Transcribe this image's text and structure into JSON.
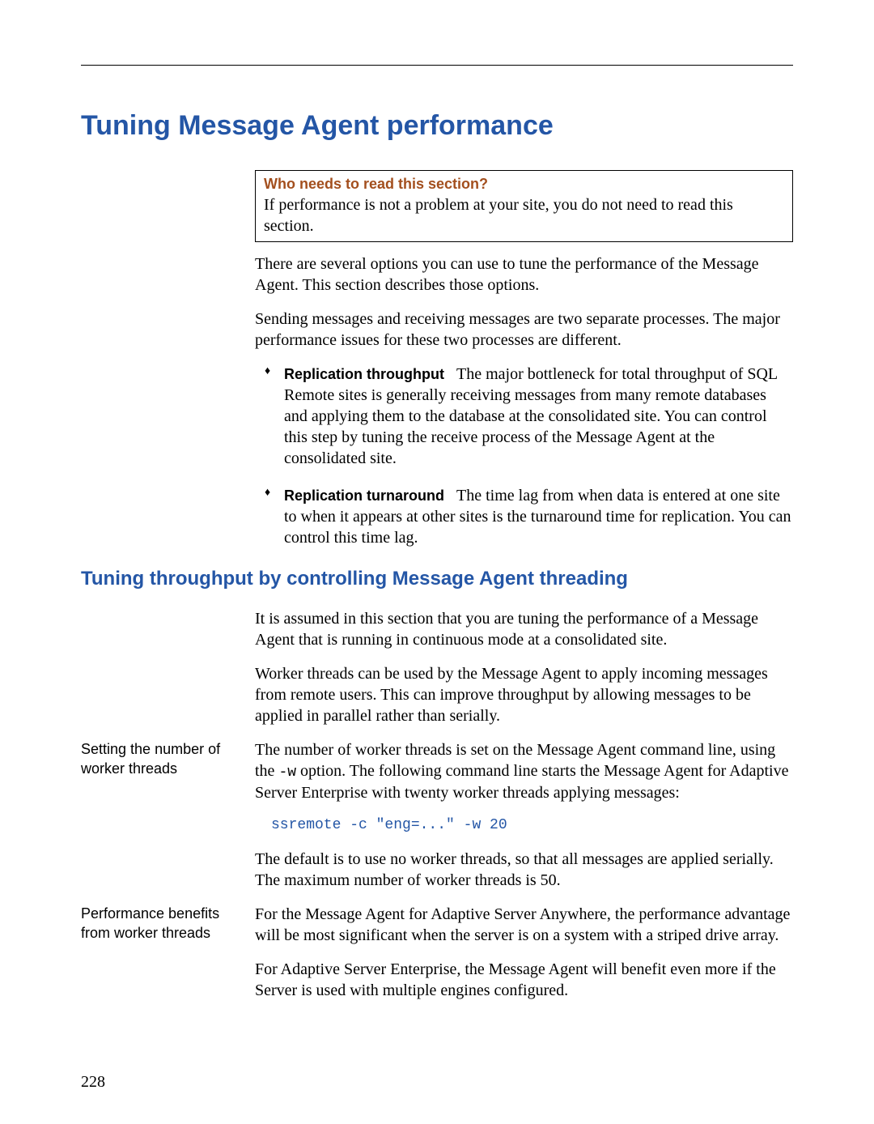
{
  "page_number": "228",
  "title": "Tuning Message Agent performance",
  "callout": {
    "heading": "Who needs to read this section?",
    "body": "If performance is not a problem at your site, you do not need to read this section."
  },
  "intro_paras": [
    "There are several options you can use to tune the performance of the Message Agent. This section describes those options.",
    "Sending messages and receiving messages are two separate processes. The major performance issues for these two processes are different."
  ],
  "bullets": [
    {
      "label": "Replication throughput",
      "text": "The major bottleneck for total throughput of SQL Remote sites is generally receiving messages from many remote databases and applying them to the database at the consolidated site. You can control this step by tuning the receive process of the Message Agent at the consolidated site."
    },
    {
      "label": "Replication turnaround",
      "text": "The time lag from when data is entered at one site to when it appears at other sites is the turnaround time for replication. You can control this time lag."
    }
  ],
  "subsection_title": "Tuning throughput by controlling Message Agent threading",
  "sub_intro": [
    "It is assumed in this section that you are tuning the performance of a Message Agent that is running in continuous mode at a consolidated site.",
    "Worker threads can be used by the Message Agent to apply incoming messages from remote users. This can improve throughput by allowing messages to be applied in parallel rather than serially."
  ],
  "setting_block": {
    "side": "Setting the number of worker threads",
    "p1a": "The number of worker threads is set on the Message Agent command line, using the ",
    "p1_option": "-w",
    "p1b": " option. The following command line starts the Message Agent for Adaptive Server Enterprise with twenty worker threads applying messages:",
    "code": "ssremote -c \"eng=...\" -w 20",
    "p2": "The default is to use no worker threads, so that all messages are applied serially. The maximum number of worker threads is 50."
  },
  "perf_block": {
    "side": "Performance benefits from worker threads",
    "p1": "For the Message Agent for Adaptive Server Anywhere, the performance advantage will be most significant when the server is on a system with a striped drive array.",
    "p2": "For Adaptive Server Enterprise, the Message Agent will benefit even more if the Server is used with multiple engines configured."
  }
}
